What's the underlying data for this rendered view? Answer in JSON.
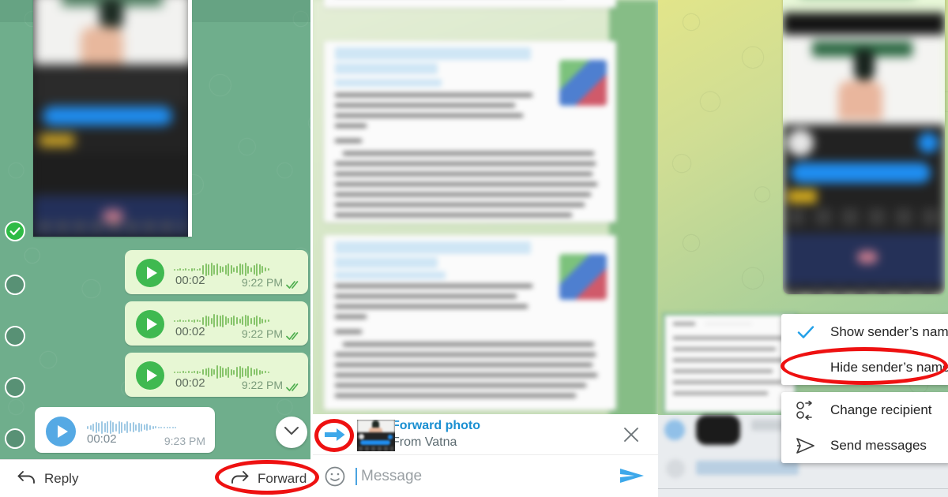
{
  "left_panel": {
    "name": "selected-messages-chat",
    "selection": {
      "checked_index": 0,
      "circle_count": 5
    },
    "voice_messages": [
      {
        "duration": "00:02",
        "time": "9:22 PM",
        "direction": "out",
        "status": "read"
      },
      {
        "duration": "00:02",
        "time": "9:22 PM",
        "direction": "out",
        "status": "read"
      },
      {
        "duration": "00:02",
        "time": "9:22 PM",
        "direction": "out",
        "status": "read"
      },
      {
        "duration": "00:02",
        "time": "9:23 PM",
        "direction": "in",
        "status": "none"
      }
    ],
    "action_bar": {
      "reply_label": "Reply",
      "forward_label": "Forward",
      "reply_icon": "reply-arrow-icon",
      "forward_icon": "forward-arrow-icon"
    },
    "scroll_down_icon": "chevron-down-icon",
    "highlight_color": "#ee1111",
    "background_color": "#6fae8c",
    "bubble_out_color": "#e7f7d4",
    "bubble_in_color": "#ffffff",
    "play_out_color": "#3fb950",
    "play_in_color": "#55a9e4"
  },
  "middle_panel": {
    "name": "forward-target-chat",
    "forward_preview": {
      "title": "Forward photo",
      "subtitle": "From Vatna",
      "arrow_icon": "forward-arrow-blue-icon",
      "close_icon": "close-icon",
      "thumbnail": "forwarded-photo-thumbnail",
      "accent_color": "#1a8fd1"
    },
    "composer": {
      "placeholder": "Message",
      "value": "",
      "emoji_icon": "smiley-icon",
      "send_icon": "send-icon"
    },
    "documents": [
      {
        "name": "document-message-1"
      },
      {
        "name": "document-message-2"
      },
      {
        "name": "document-message-3"
      }
    ]
  },
  "right_panel": {
    "name": "forward-options-chat",
    "context_menu": {
      "groups": [
        {
          "items": [
            {
              "label": "Show sender’s name",
              "icon": "check-icon",
              "checked": true
            },
            {
              "label": "Hide sender’s name",
              "icon": "",
              "checked": false,
              "highlighted": true
            }
          ]
        },
        {
          "items": [
            {
              "label": "Change recipient",
              "icon": "swap-users-icon",
              "checked": false
            },
            {
              "label": "Send messages",
              "icon": "send-outline-icon",
              "checked": false
            }
          ]
        }
      ],
      "check_color": "#22a0e8",
      "highlight_color": "#ee1111"
    },
    "photo_bubble": "forwarded-photo-preview",
    "background_gradient": [
      "#e2e58a",
      "#8cc59f"
    ]
  }
}
